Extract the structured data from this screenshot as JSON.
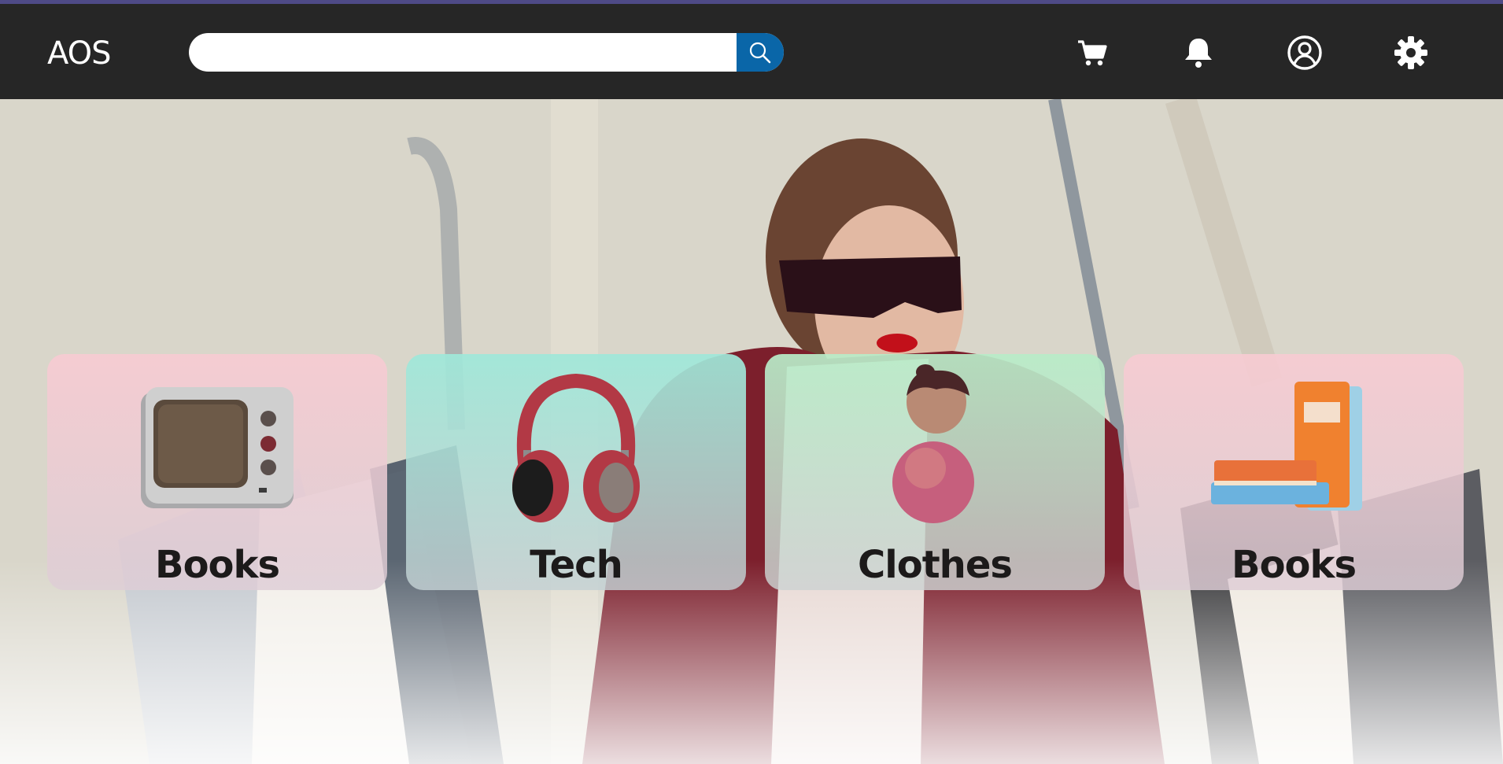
{
  "app": {
    "brand": "AOS"
  },
  "search": {
    "placeholder": "",
    "value": ""
  },
  "nav": {
    "icons": [
      "cart-icon",
      "bell-icon",
      "user-icon",
      "settings-icon"
    ]
  },
  "categories": [
    {
      "label": "Books",
      "icon": "retro-tv-icon",
      "color": "#f2c6cc"
    },
    {
      "label": "Tech",
      "icon": "headphones-icon",
      "color": "#9fe8d9"
    },
    {
      "label": "Clothes",
      "icon": "abstract-figure-icon",
      "color": "#b8ecc8"
    },
    {
      "label": "Books",
      "icon": "books-stack-icon",
      "color": "#f2c6cc"
    }
  ],
  "colors": {
    "navbar": "#262626",
    "accent_strip": "#4e4a86",
    "search_button": "#0a66a8"
  }
}
